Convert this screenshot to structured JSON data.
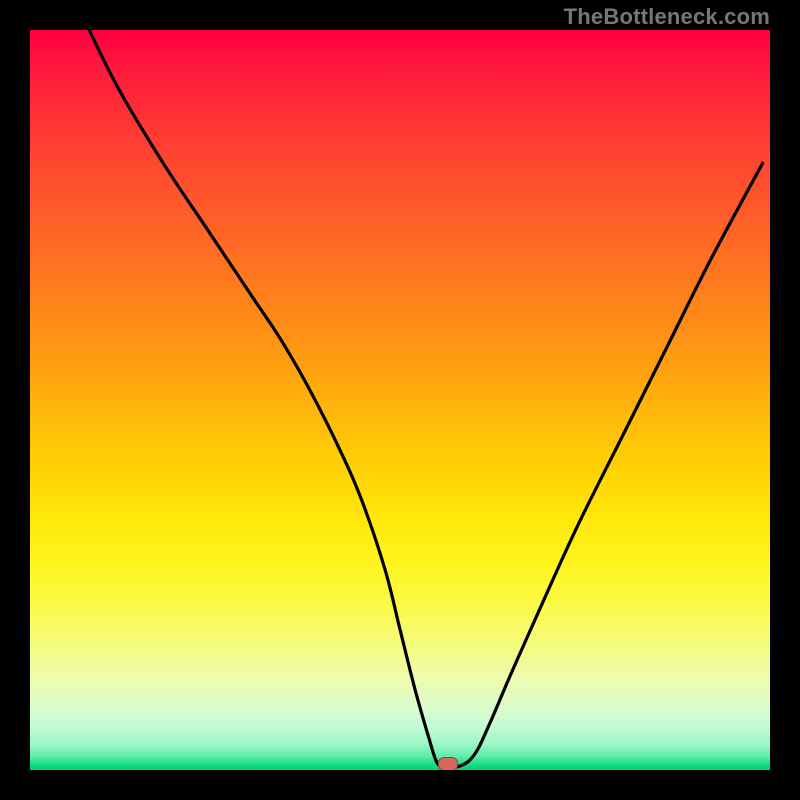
{
  "watermark": "TheBottleneck.com",
  "chart_data": {
    "type": "line",
    "title": "",
    "xlabel": "",
    "ylabel": "",
    "xlim": [
      0,
      100
    ],
    "ylim": [
      0,
      100
    ],
    "grid": false,
    "series": [
      {
        "name": "curve",
        "x": [
          8,
          12,
          18,
          24,
          30,
          34,
          38,
          42,
          45,
          48,
          50,
          52,
          54,
          55,
          56,
          58,
          60,
          62,
          65,
          69,
          74,
          80,
          86,
          92,
          99
        ],
        "y": [
          100,
          92,
          82,
          73,
          64,
          58,
          51,
          43,
          36,
          27,
          19,
          11,
          4,
          1,
          0.5,
          0.5,
          2,
          6,
          13,
          22,
          33,
          45,
          57,
          69,
          82
        ]
      }
    ],
    "marker": {
      "x": 56.5,
      "y": 0.8
    },
    "background_gradient": {
      "top": "#ff0040",
      "bottom": "#00d070",
      "stops": [
        "#ff0040",
        "#ff5a2a",
        "#ff9a12",
        "#ffd406",
        "#fff41e",
        "#eefcac",
        "#5eecaa",
        "#00d070"
      ]
    }
  }
}
